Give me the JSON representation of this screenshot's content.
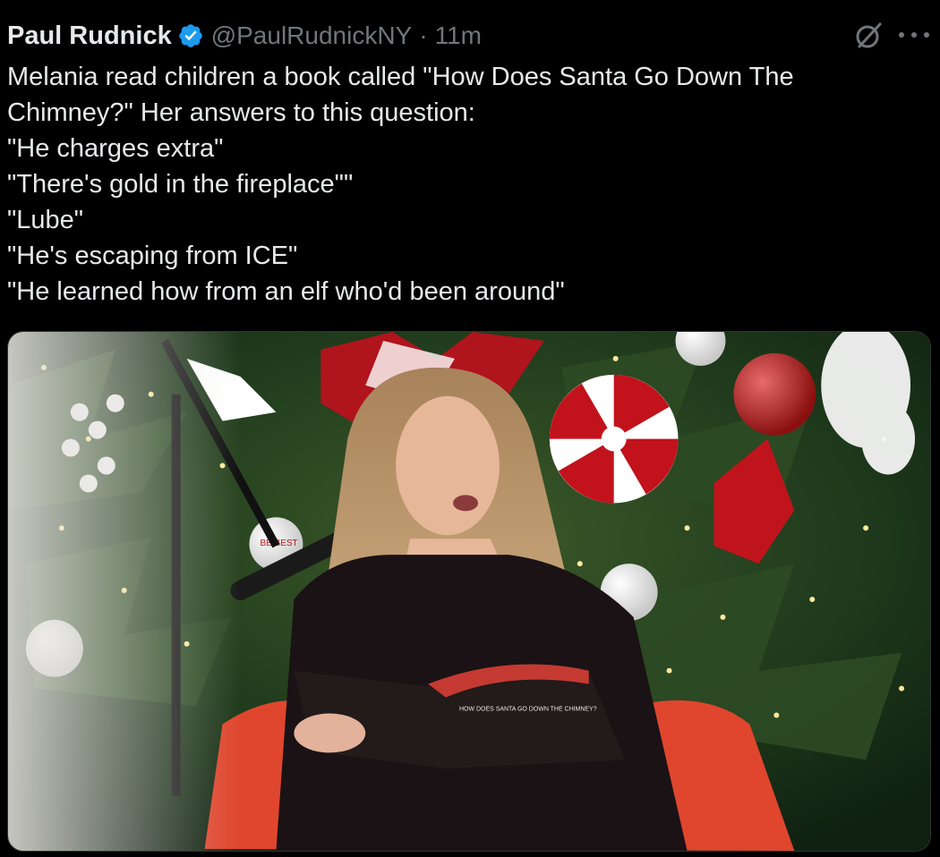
{
  "author": {
    "display_name": "Paul Rudnick",
    "handle": "@PaulRudnickNY",
    "separator": "·",
    "time": "11m",
    "verified": true
  },
  "icons": {
    "verified": "verified-badge-icon",
    "grok": "grok-icon",
    "more": "more-options-icon"
  },
  "tweet": {
    "lines": [
      "Melania read children a book called \"How Does Santa Go Down The",
      "Chimney?\" Her answers to this question:",
      "\"He charges extra\"",
      "\"There's gold in the fireplace\"\"",
      "\"Lube\"",
      "\"He's escaping from ICE\"",
      "\"He learned how from an elf who'd been around\""
    ]
  },
  "media": {
    "type": "photo",
    "ornament_text": "BE BEST",
    "book_cover_text": "HOW DOES SANTA GO DOWN THE CHIMNEY?"
  },
  "colors": {
    "background": "#000000",
    "text_primary": "#e7e9ea",
    "text_secondary": "#71767b",
    "verified_blue": "#1d9bf0",
    "border": "#2f3336"
  }
}
